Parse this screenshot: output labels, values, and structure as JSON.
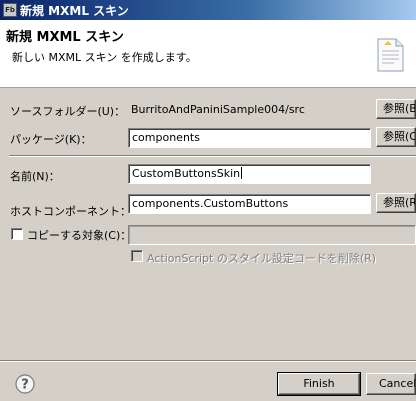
{
  "window": {
    "title": "新規 MXML スキン",
    "icon_text": "Fb"
  },
  "banner": {
    "heading": "新規 MXML スキン",
    "description": "新しい MXML スキン を作成します。",
    "icon": "document-wizard-icon"
  },
  "form": {
    "source_folder": {
      "label": "ソースフォルダー(U)：",
      "value": "BurritoAndPaniniSample004/src",
      "browse": "参照(B"
    },
    "package": {
      "label": "パッケージ(K)：",
      "value": "components",
      "browse": "参照(O"
    },
    "name": {
      "label": "名前(N)：",
      "value": "CustomButtonsSkin"
    },
    "host_component": {
      "label": "ホストコンポーネント：",
      "value": "components.CustomButtons",
      "browse": "参照(R"
    },
    "copy_from": {
      "label": "コピーする対象(C)：",
      "value": "",
      "checked": false
    },
    "remove_actionscript": {
      "label": "ActionScript のスタイル設定コードを削除(R)",
      "checked": false,
      "enabled": false
    }
  },
  "footer": {
    "help_icon": "help-question-icon",
    "finish": "Finish",
    "cancel": "Cancel"
  }
}
